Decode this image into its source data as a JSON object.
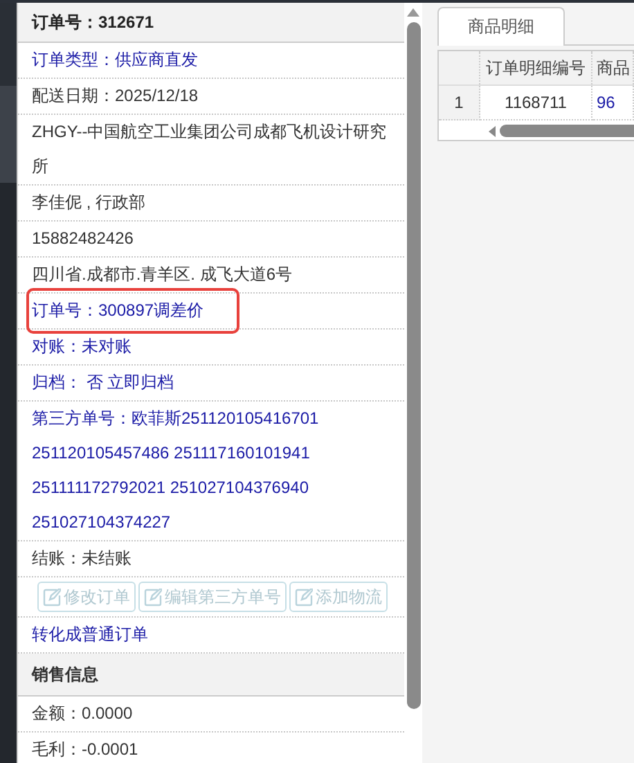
{
  "order_panel": {
    "title": "订单号：312671",
    "rows": [
      {
        "kind": "link",
        "lines": [
          "订单类型：供应商直发"
        ],
        "highlighted": false
      },
      {
        "kind": "text",
        "lines": [
          "配送日期：2025/12/18"
        ],
        "highlighted": false
      },
      {
        "kind": "text",
        "lines": [
          "ZHGY--中国航空工业集团公司成都飞机设计研究",
          "所"
        ],
        "highlighted": false
      },
      {
        "kind": "text",
        "lines": [
          "李佳伲 , 行政部"
        ],
        "highlighted": false
      },
      {
        "kind": "text",
        "lines": [
          "15882482426"
        ],
        "highlighted": false
      },
      {
        "kind": "text",
        "lines": [
          "四川省.成都市.青羊区. 成飞大道6号"
        ],
        "highlighted": false
      },
      {
        "kind": "link",
        "lines": [
          "订单号：300897调差价"
        ],
        "highlighted": true
      },
      {
        "kind": "link",
        "lines": [
          "对账：未对账"
        ],
        "highlighted": false
      },
      {
        "kind": "link",
        "lines": [
          "归档： 否 立即归档"
        ],
        "highlighted": false
      },
      {
        "kind": "link",
        "lines": [
          "第三方单号：欧菲斯251120105416701",
          "251120105457486 251117160101941",
          "251111172792021 251027104376940",
          "251027104374227"
        ],
        "highlighted": false
      },
      {
        "kind": "text",
        "lines": [
          "结账：未结账"
        ],
        "highlighted": false
      }
    ],
    "actions": [
      {
        "label": "修改订单",
        "disabled": true
      },
      {
        "label": "编辑第三方单号",
        "disabled": true
      },
      {
        "label": "添加物流",
        "disabled": true
      }
    ],
    "convert_link": "转化成普通订单",
    "sales_section": {
      "title": "销售信息",
      "rows": [
        "金额：0.0000",
        "毛利：-0.0001"
      ]
    }
  },
  "detail_tabs": [
    {
      "label": "商品明细",
      "selected": true
    }
  ],
  "detail_table": {
    "columns": [
      "",
      "订单明细编号",
      "商品"
    ],
    "rows": [
      {
        "cells": [
          "1",
          "1168711",
          "96"
        ]
      }
    ]
  }
}
